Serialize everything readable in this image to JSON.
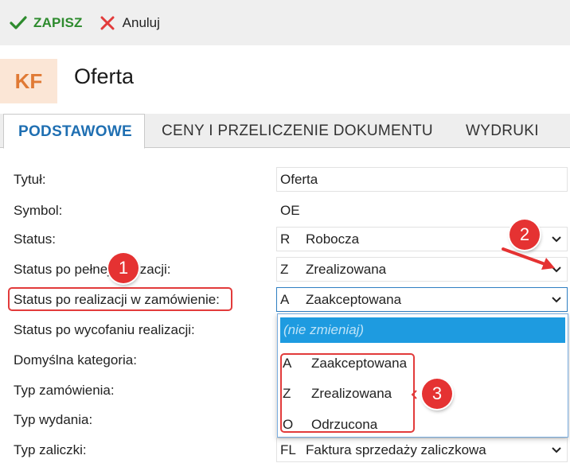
{
  "toolbar": {
    "save_label": "ZAPISZ",
    "cancel_label": "Anuluj"
  },
  "header": {
    "badge": "KF",
    "title": "Oferta"
  },
  "tabs": [
    {
      "label": "PODSTAWOWE",
      "active": true
    },
    {
      "label": "CENY I PRZELICZENIE DOKUMENTU",
      "active": false
    },
    {
      "label": "WYDRUKI",
      "active": false
    }
  ],
  "form": {
    "labels": {
      "title": "Tytuł:",
      "symbol": "Symbol:",
      "status": "Status:",
      "status_full": "Status po pełnej realizacji:",
      "status_order": "Status po realizacji w zamówienie:",
      "status_withdraw": "Status po wycofaniu realizacji:",
      "default_category": "Domyślna kategoria:",
      "order_type": "Typ zamówienia:",
      "issue_type": "Typ wydania:",
      "advance_type": "Typ zaliczki:"
    },
    "values": {
      "title": "Oferta",
      "symbol": "OE",
      "status": {
        "code": "R",
        "label": "Robocza"
      },
      "status_full": {
        "code": "Z",
        "label": "Zrealizowana"
      },
      "status_order": {
        "code": "A",
        "label": "Zaakceptowana"
      },
      "advance_type": {
        "code": "FL",
        "label": "Faktura sprzedaży zaliczkowa"
      }
    }
  },
  "dropdown": {
    "first": "(nie zmieniaj)",
    "options": [
      {
        "code": "A",
        "label": "Zaakceptowana"
      },
      {
        "code": "Z",
        "label": "Zrealizowana"
      },
      {
        "code": "O",
        "label": "Odrzucona"
      }
    ]
  },
  "annotations": {
    "badge1": "1",
    "badge2": "2",
    "badge3": "3"
  },
  "colors": {
    "accent": "#1f6fb2",
    "save": "#2e8b2e",
    "cancel": "#e23b3b",
    "highlight": "#e23b3b",
    "selection": "#1e9be0",
    "badge_bg": "#fbe6d6",
    "badge_fg": "#e07a35"
  }
}
